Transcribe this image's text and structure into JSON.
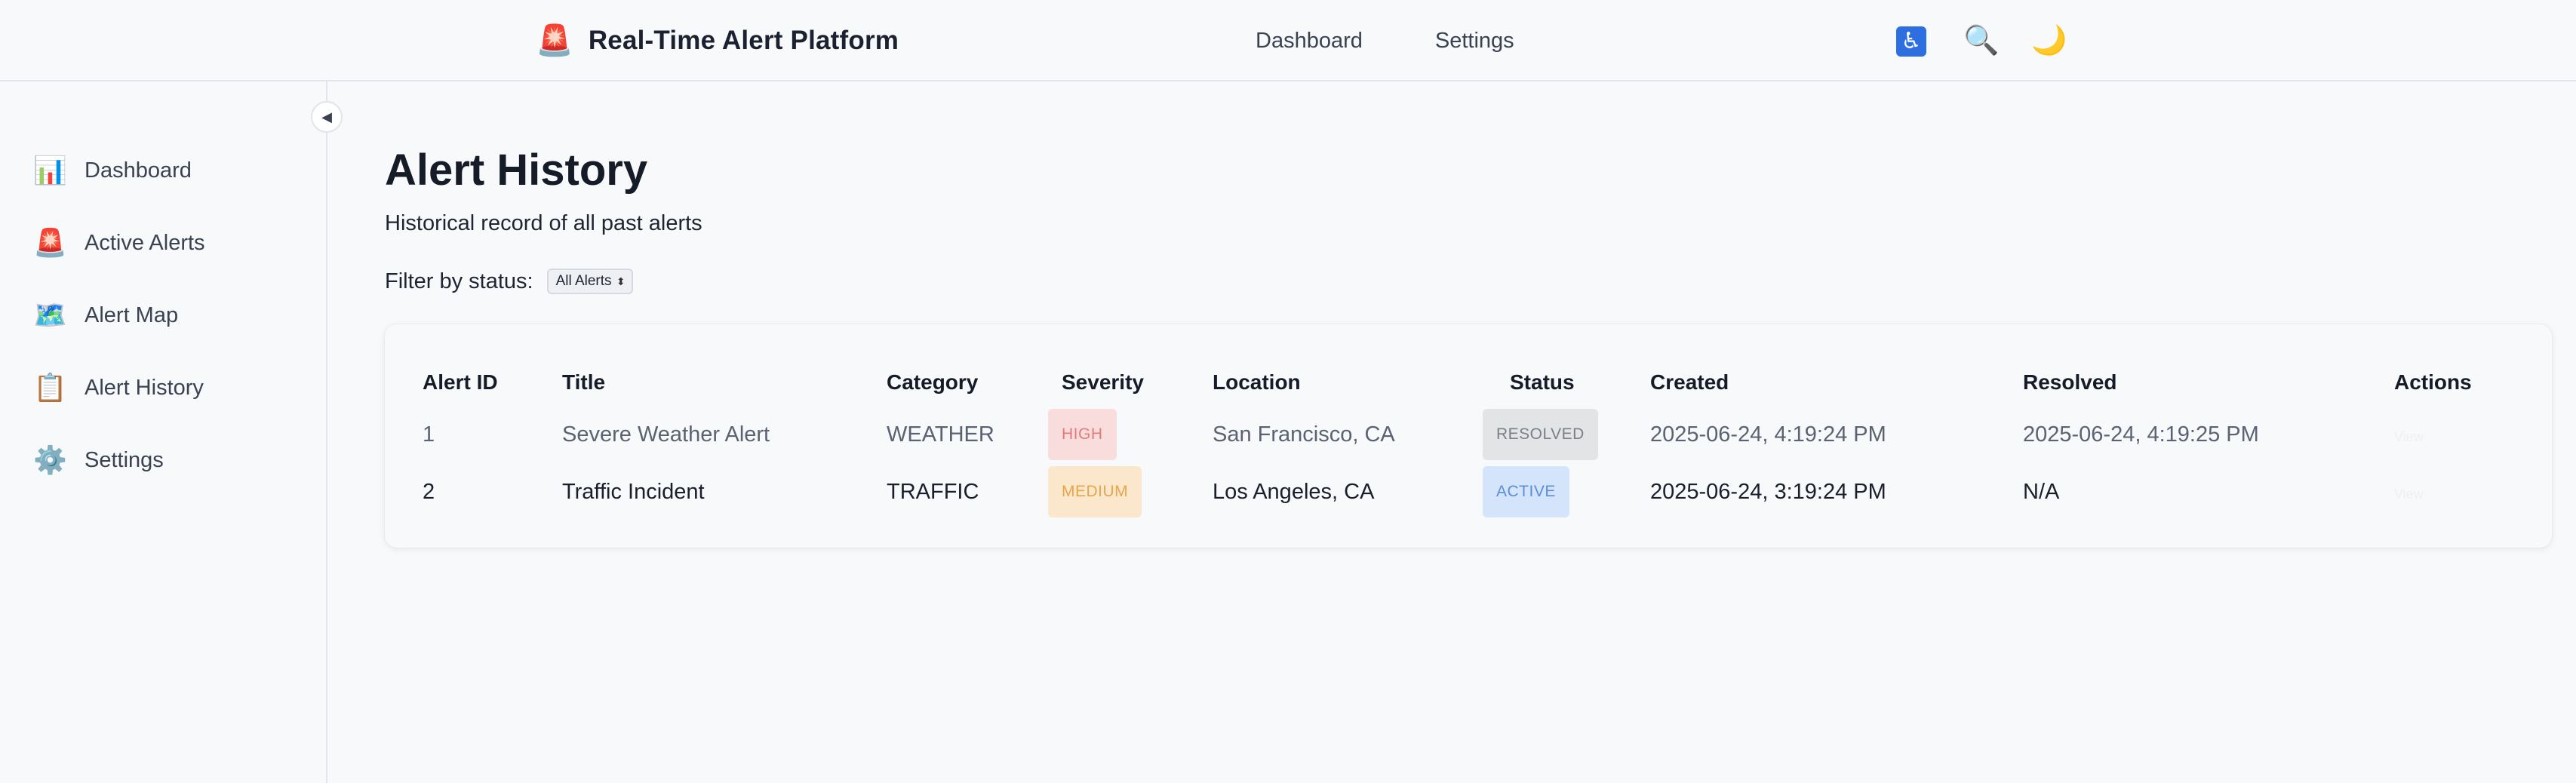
{
  "header": {
    "logo_icon": "🚨",
    "title": "Real-Time Alert Platform",
    "nav": [
      "Dashboard",
      "Settings"
    ],
    "icons": {
      "accessibility": "♿",
      "search": "🔍",
      "theme": "🌙"
    }
  },
  "sidebar": {
    "collapse_icon": "◀",
    "items": [
      {
        "icon": "📊",
        "label": "Dashboard"
      },
      {
        "icon": "🚨",
        "label": "Active Alerts"
      },
      {
        "icon": "🗺️",
        "label": "Alert Map"
      },
      {
        "icon": "📋",
        "label": "Alert History"
      },
      {
        "icon": "⚙️",
        "label": "Settings"
      }
    ]
  },
  "main": {
    "title": "Alert History",
    "subtitle": "Historical record of all past alerts",
    "filter": {
      "label": "Filter by status:",
      "selected": "All Alerts"
    },
    "table": {
      "columns": [
        "Alert ID",
        "Title",
        "Category",
        "Severity",
        "Location",
        "Status",
        "Created",
        "Resolved",
        "Actions"
      ],
      "rows": [
        {
          "id": "1",
          "title": "Severe Weather Alert",
          "category": "WEATHER",
          "severity": "HIGH",
          "location": "San Francisco, CA",
          "status": "RESOLVED",
          "created": "2025-06-24, 4:19:24 PM",
          "resolved": "2025-06-24, 4:19:25 PM",
          "action": "View"
        },
        {
          "id": "2",
          "title": "Traffic Incident",
          "category": "TRAFFIC",
          "severity": "MEDIUM",
          "location": "Los Angeles, CA",
          "status": "ACTIVE",
          "created": "2025-06-24, 3:19:24 PM",
          "resolved": "N/A",
          "action": "View"
        }
      ]
    }
  }
}
